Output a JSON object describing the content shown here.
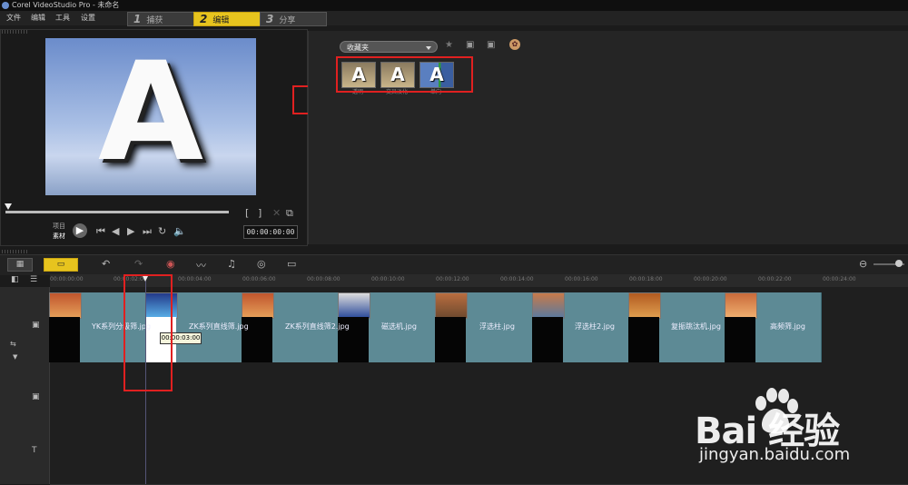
{
  "window": {
    "title": "Corel VideoStudio Pro - 未命名"
  },
  "menu": {
    "items": [
      "文件",
      "编辑",
      "工具",
      "设置"
    ]
  },
  "steps": [
    {
      "num": "1",
      "label": "捕获"
    },
    {
      "num": "2",
      "label": "编辑"
    },
    {
      "num": "3",
      "label": "分享"
    }
  ],
  "preview": {
    "letter": "A",
    "project_label": "项目",
    "clip_label": "素材",
    "timecode": "00:00:00:00"
  },
  "library": {
    "dropdown_value": "收藏夹",
    "thumbnails": [
      {
        "letter": "A",
        "label": "透明"
      },
      {
        "letter": "A",
        "label": "交叉淡化"
      },
      {
        "letter": "A",
        "label": "单向"
      }
    ]
  },
  "timeline": {
    "ruler_ticks": [
      "00:00:00:00",
      "00:00:02:00",
      "00:00:04:00",
      "00:00:06:00",
      "00:00:08:00",
      "00:00:10:00",
      "00:00:12:00",
      "00:00:14:00",
      "00:00:16:00",
      "00:00:18:00",
      "00:00:20:00",
      "00:00:22:00",
      "00:00:24:00"
    ],
    "tooltip": "00:00:03:00",
    "clips": [
      "YK系列分级筛.jpg",
      "ZK系列直线筛.jpg",
      "ZK系列直线筛2.jpg",
      "磁选机.jpg",
      "浮选柱.jpg",
      "浮选柱2.jpg",
      "复振跳汰机.jpg",
      "高频筛.jpg"
    ]
  },
  "watermark": {
    "brand_text": "Bai 经验",
    "url": "jingyan.baidu.com"
  },
  "colors": {
    "accent": "#e7c41e",
    "clip": "#5d8a95",
    "highlight": "#e02020"
  }
}
